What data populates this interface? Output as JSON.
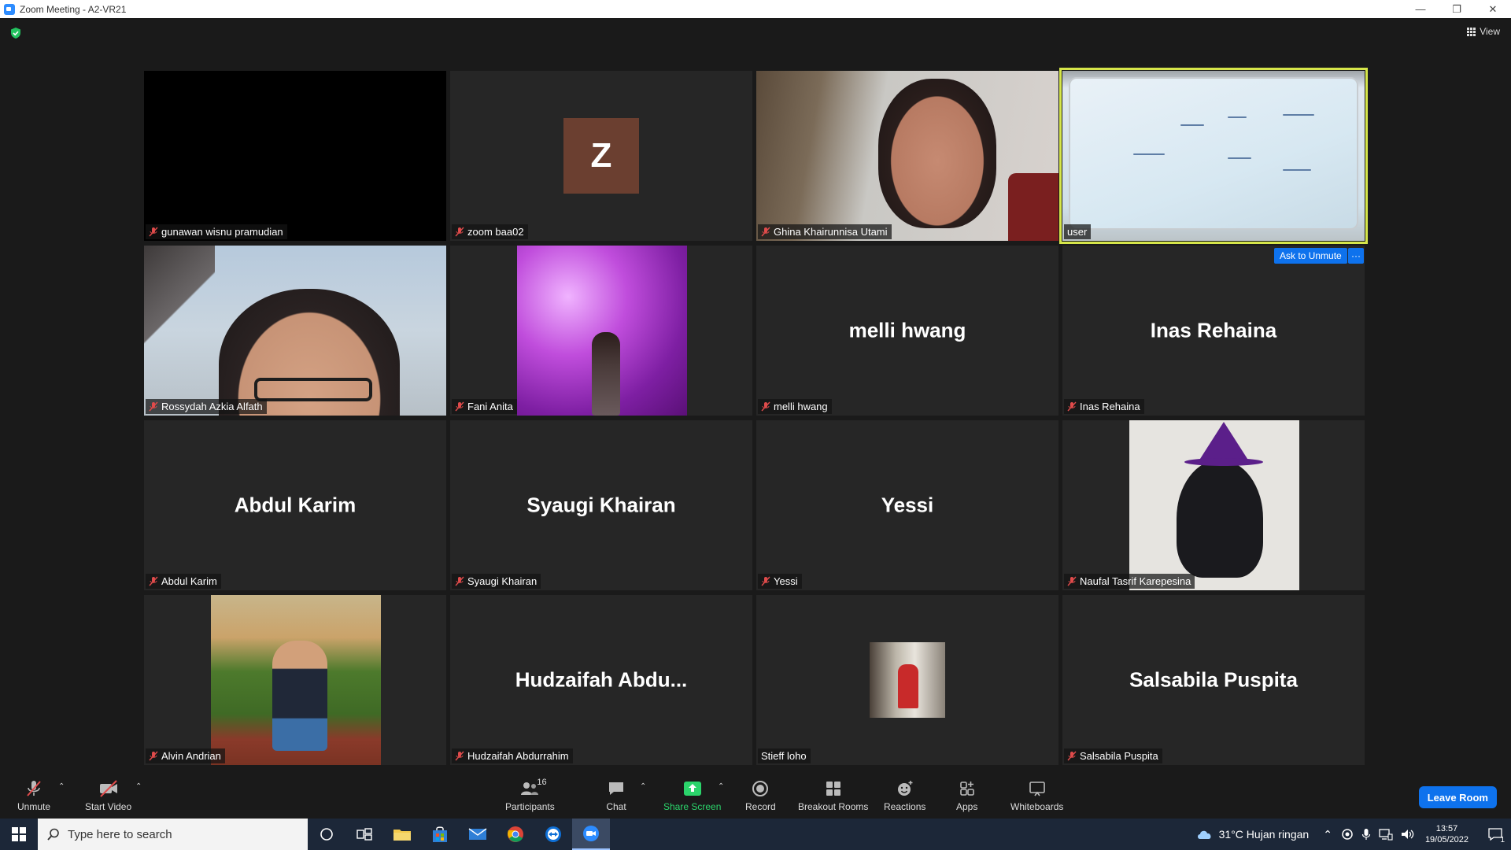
{
  "window": {
    "title": "Zoom Meeting - A2-VR21"
  },
  "top": {
    "view_label": "View"
  },
  "participants": [
    {
      "name": "gunawan wisnu pramudian",
      "muted": true,
      "display": "black"
    },
    {
      "name": "zoom baa02",
      "muted": true,
      "display": "avatar",
      "avatar_letter": "Z"
    },
    {
      "name": "Ghina Khairunnisa Utami",
      "muted": true,
      "display": "video"
    },
    {
      "name": "user",
      "muted": false,
      "display": "video",
      "active_speaker": true
    },
    {
      "name": "Rossydah Azkia Alfath",
      "muted": true,
      "display": "video"
    },
    {
      "name": "Fani Anita",
      "muted": true,
      "display": "photo"
    },
    {
      "name": "melli hwang",
      "muted": true,
      "display": "name",
      "big_name": "melli hwang"
    },
    {
      "name": "Inas Rehaina",
      "muted": true,
      "display": "name",
      "big_name": "Inas Rehaina"
    },
    {
      "name": "Abdul Karim",
      "muted": true,
      "display": "name",
      "big_name": "Abdul Karim"
    },
    {
      "name": "Syaugi Khairan",
      "muted": true,
      "display": "name",
      "big_name": "Syaugi Khairan"
    },
    {
      "name": "Yessi",
      "muted": true,
      "display": "name",
      "big_name": "Yessi"
    },
    {
      "name": "Naufal Tasrif Karepesina",
      "muted": true,
      "display": "photo"
    },
    {
      "name": "Alvin Andrian",
      "muted": true,
      "display": "photo"
    },
    {
      "name": "Hudzaifah Abdurrahim",
      "muted": true,
      "display": "name",
      "big_name": "Hudzaifah  Abdu..."
    },
    {
      "name": "Stieff loho",
      "muted": false,
      "display": "photo"
    },
    {
      "name": "Salsabila Puspita",
      "muted": true,
      "display": "name",
      "big_name": "Salsabila Puspita"
    }
  ],
  "host_actions": {
    "ask_to_unmute": "Ask to Unmute",
    "more": "···"
  },
  "toolbar": {
    "unmute": "Unmute",
    "start_video": "Start Video",
    "participants": "Participants",
    "participants_count": "16",
    "chat": "Chat",
    "share_screen": "Share Screen",
    "record": "Record",
    "breakout_rooms": "Breakout Rooms",
    "reactions": "Reactions",
    "apps": "Apps",
    "whiteboards": "Whiteboards",
    "leave": "Leave Room"
  },
  "taskbar": {
    "search_placeholder": "Type here to search",
    "weather": "31°C  Hujan ringan",
    "time": "13:57",
    "date": "19/05/2022",
    "notification_count": "1"
  },
  "colors": {
    "accent": "#0e72ed",
    "active_speaker": "#d6e64a",
    "share_green": "#2bd46b",
    "mute_red": "#e04b4b"
  }
}
